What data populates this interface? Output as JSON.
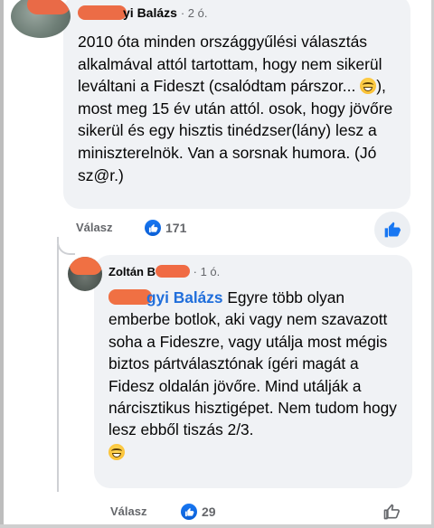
{
  "comment1": {
    "author_visible": "yi Balázs",
    "time": "· 2 ó.",
    "text_before_emoji": "2010 óta minden országgyűlési választás alkalmával attól tartottam, hogy nem sikerül leváltani a Fideszt (csalódtam párszor... ",
    "text_after_emoji": "), most meg 15 év után attól. osok, hogy jövőre sikerül és egy hisztis tinédzser(lány) lesz a miniszterelnök. Van a sorsnak humora. (Jó sz@r.)",
    "reply_label": "Válasz",
    "like_count": "171"
  },
  "comment2": {
    "author_visible": "Zoltán B",
    "time": "· 1 ó.",
    "mention_visible": "gyi Balázs",
    "text": " Egyre több olyan emberbe botlok, aki vagy nem szavazott soha a Fideszre, vagy utálja most mégis biztos pártválasztónak ígéri magát a Fidesz oldalán jövőre. Mind utálják a nárcisztikus hisztigépet. Nem tudom hogy lesz ebből tiszás 2/3.",
    "reply_label": "Válasz",
    "like_count": "29"
  },
  "icons": {
    "emoji": "grinning-face-icon",
    "like_badge": "thumbs-up-icon",
    "like_button": "thumbs-up-icon"
  },
  "colors": {
    "bubble": "#f0f2f5",
    "accent": "#1877f2",
    "mention": "#216fdb",
    "meta": "#65676b"
  }
}
